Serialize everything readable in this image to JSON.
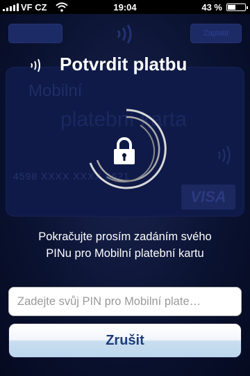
{
  "status_bar": {
    "carrier": "VF CZ",
    "time": "19:04",
    "battery_percent": "43 %",
    "battery_level": 0.43
  },
  "background_app": {
    "right_button": "Zaplatit",
    "card": {
      "title_line1": "Mobilní",
      "title_line2": "platební karta",
      "number": "4598 XXXX XXXX 0621",
      "brand": "VISA"
    }
  },
  "dialog": {
    "title": "Potvrdit platbu",
    "message_line1": "Pokračujte prosím zadáním svého",
    "message_line2": "PINu pro Mobilní platební kartu",
    "pin_placeholder": "Zadejte svůj PIN pro Mobilní plate…",
    "pin_value": "",
    "cancel_label": "Zrušit",
    "icons": {
      "title_icon": "nfc-icon",
      "center_icon": "lock-icon",
      "progress": "spinner"
    }
  },
  "colors": {
    "title_text": "#ffffff",
    "cancel_text": "#1f3c7a",
    "overlay_background": "#0a1230"
  }
}
